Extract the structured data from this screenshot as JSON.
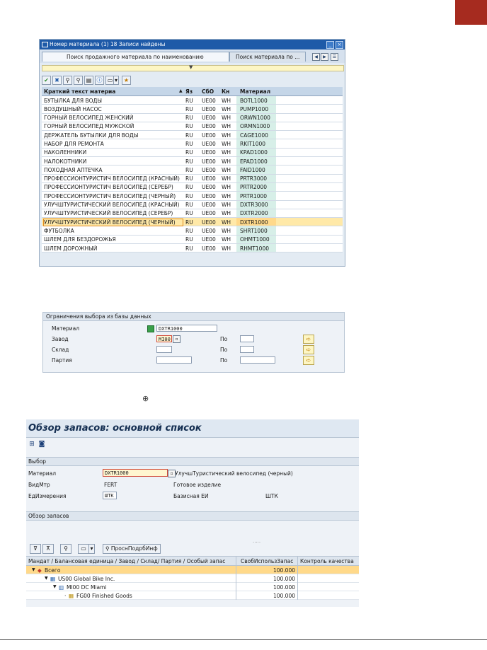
{
  "colors": {
    "accent_red": "#a62b1f",
    "sap_blue": "#1e5aa8",
    "highlight": "#ffd98a"
  },
  "search_dialog": {
    "title": "Номер материала (1)  18 Записи найдены",
    "tabs": [
      "Поиск продажного материала по наименованию",
      "Поиск материала по ..."
    ],
    "toolbar_icons": [
      "check-icon",
      "cancel-icon",
      "find-icon",
      "find-next-icon",
      "filter-icon",
      "info-icon",
      "print-icon",
      "layout-dropdown-icon",
      "personal-list-icon"
    ],
    "columns": [
      "Краткий текст материа",
      "Яз",
      "СбО",
      "Кн",
      "Материал"
    ],
    "rows": [
      [
        "БУТЫЛКА ДЛЯ ВОДЫ",
        "RU",
        "UE00",
        "WH",
        "BOTL1000"
      ],
      [
        "ВОЗДУШНЫЙ НАСОС",
        "RU",
        "UE00",
        "WH",
        "PUMP1000"
      ],
      [
        "ГОРНЫЙ ВЕЛОСИПЕД ЖЕНСКИЙ",
        "RU",
        "UE00",
        "WH",
        "ORWN1000"
      ],
      [
        "ГОРНЫЙ ВЕЛОСИПЕД МУЖСКОЙ",
        "RU",
        "UE00",
        "WH",
        "ORMN1000"
      ],
      [
        "ДЕРЖАТЕЛЬ БУТЫЛКИ ДЛЯ ВОДЫ",
        "RU",
        "UE00",
        "WH",
        "CAGE1000"
      ],
      [
        "НАБОР ДЛЯ РЕМОНТА",
        "RU",
        "UE00",
        "WH",
        "RKIT1000"
      ],
      [
        "НАКОЛЕННИКИ",
        "RU",
        "UE00",
        "WH",
        "KPAD1000"
      ],
      [
        "НАЛОКОТНИКИ",
        "RU",
        "UE00",
        "WH",
        "EPAD1000"
      ],
      [
        "ПОХОДНАЯ АПТЕЧКА",
        "RU",
        "UE00",
        "WH",
        "FAID1000"
      ],
      [
        "ПРОФЕССИОНТУРИСТИЧ ВЕЛОСИПЕД (КРАСНЫЙ)",
        "RU",
        "UE00",
        "WH",
        "PRTR3000"
      ],
      [
        "ПРОФЕССИОНТУРИСТИЧ ВЕЛОСИПЕД (СЕРЕБР)",
        "RU",
        "UE00",
        "WH",
        "PRTR2000"
      ],
      [
        "ПРОФЕССИОНТУРИСТИЧ ВЕЛОСИПЕД (ЧЕРНЫЙ)",
        "RU",
        "UE00",
        "WH",
        "PRTR1000"
      ],
      [
        "УЛУЧШТУРИСТИЧЕСКИЙ ВЕЛОСИПЕД (КРАСНЫЙ)",
        "RU",
        "UE00",
        "WH",
        "DXTR3000"
      ],
      [
        "УЛУЧШТУРИСТИЧЕСКИЙ ВЕЛОСИПЕД (СЕРЕБР)",
        "RU",
        "UE00",
        "WH",
        "DXTR2000"
      ],
      [
        "УЛУЧШТУРИСТИЧЕСКИЙ ВЕЛОСИПЕД (ЧЕРНЫЙ)",
        "RU",
        "UE00",
        "WH",
        "DXTR1000"
      ],
      [
        "ФУТБОЛКА",
        "RU",
        "UE00",
        "WH",
        "SHRT1000"
      ],
      [
        "ШЛЕМ ДЛЯ БЕЗДОРОЖЬЯ",
        "RU",
        "UE00",
        "WH",
        "OHMT1000"
      ],
      [
        "ШЛЕМ ДОРОЖНЫЙ",
        "RU",
        "UE00",
        "WH",
        "RHMT1000"
      ]
    ],
    "selected_row_index": 14
  },
  "db_restrictions": {
    "title": "Ограничения выбора из базы данных",
    "labels": {
      "material": "Материал",
      "plant": "Завод",
      "storage": "Склад",
      "batch": "Партия",
      "to": "По"
    },
    "values": {
      "material": "DXTR1000",
      "plant": "MI00",
      "storage": "",
      "batch": ""
    }
  },
  "stock_overview": {
    "title": "Обзор запасов: основной список",
    "selection_label": "Выбор",
    "fields": {
      "material_label": "Материал",
      "material_value": "DXTR1000",
      "material_text": "УлучшТуристический велосипед (черный)",
      "matl_type_label": "ВидМтр",
      "matl_type_value": "FERT",
      "matl_type_text": "Готовое изделие",
      "uom_label": "ЕдИзмерения",
      "uom_value": "ШТК",
      "base_uom_label": "Базисная ЕИ",
      "base_uom_value": "ШТК"
    },
    "overview_label": "Обзор запасов",
    "tree_button": "ПроснПодрбИнф",
    "dots": ".....",
    "columns": [
      "Мандат / Балансовая единица / Завод / Склад/ Партия / Особый запас",
      "СвобИспользЗапас",
      "Контроль качества"
    ],
    "tree": [
      {
        "label": "Всего",
        "value": "100.000"
      },
      {
        "label": "US00 Global Bike Inc.",
        "value": "100.000"
      },
      {
        "label": "MI00 DC Miami",
        "value": "100.000"
      },
      {
        "label": "FG00 Finished Goods",
        "value": "100.000"
      }
    ]
  }
}
